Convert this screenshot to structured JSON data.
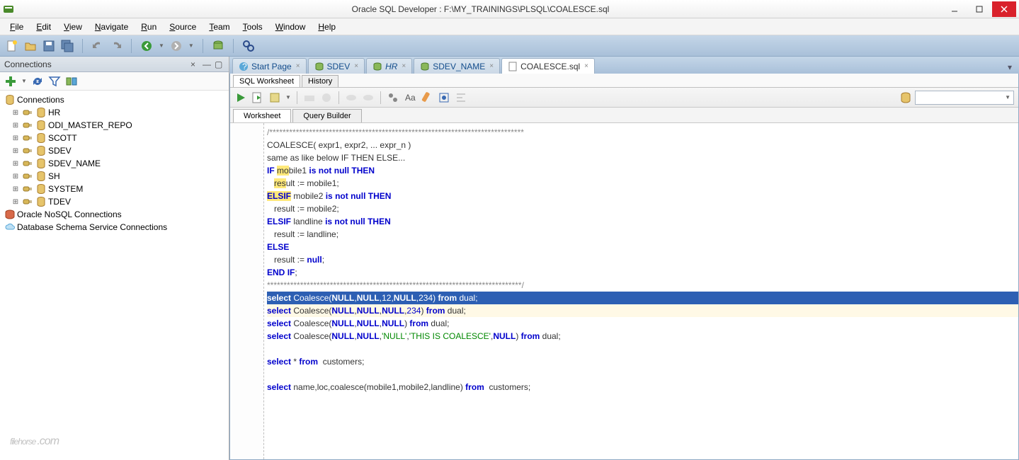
{
  "window": {
    "title": "Oracle SQL Developer : F:\\MY_TRAININGS\\PLSQL\\COALESCE.sql"
  },
  "menu": [
    "File",
    "Edit",
    "View",
    "Navigate",
    "Run",
    "Source",
    "Team",
    "Tools",
    "Window",
    "Help"
  ],
  "connections_panel": {
    "title": "Connections",
    "root": "Connections",
    "nodes": [
      "HR",
      "ODI_MASTER_REPO",
      "SCOTT",
      "SDEV",
      "SDEV_NAME",
      "SH",
      "SYSTEM",
      "TDEV"
    ],
    "extra": [
      "Oracle NoSQL Connections",
      "Database Schema Service Connections"
    ]
  },
  "doc_tabs": [
    {
      "label": "Start Page",
      "icon": "help"
    },
    {
      "label": "SDEV",
      "icon": "db"
    },
    {
      "label": "HR",
      "icon": "db",
      "italic": true
    },
    {
      "label": "SDEV_NAME",
      "icon": "db"
    },
    {
      "label": "COALESCE.sql",
      "icon": "sql",
      "active": true
    }
  ],
  "sub_tabs": [
    "SQL Worksheet",
    "History"
  ],
  "editor_tabs": [
    "Worksheet",
    "Query Builder"
  ],
  "code_lines": [
    {
      "t": "cm",
      "text": "/*****************************************************************************"
    },
    {
      "t": "id",
      "text": "COALESCE( expr1, expr2, ... expr_n )"
    },
    {
      "t": "id",
      "text": "same as like below IF THEN ELSE..."
    },
    {
      "t": "raw",
      "html": "<span class='kw'>IF</span> <span class='hl'>mo</span>bile1 <span class='kw'>is</span> <span class='kw'>not</span> <span class='kw'>null</span> <span class='kw'>THEN</span>"
    },
    {
      "t": "raw",
      "html": "   <span class='hl'>res</span>ult := mobile1;"
    },
    {
      "t": "raw",
      "html": "<span class='hl'><span class='kw'>ELSIF</span></span> mobile2 <span class='kw'>is</span> <span class='kw'>not</span> <span class='kw'>null</span> <span class='kw'>THEN</span>"
    },
    {
      "t": "id",
      "text": "   result := mobile2;"
    },
    {
      "t": "raw",
      "html": "<span class='kw'>ELSIF</span> landline <span class='kw'>is</span> <span class='kw'>not</span> <span class='kw'>null</span> <span class='kw'>THEN</span>"
    },
    {
      "t": "id",
      "text": "   result := landline;"
    },
    {
      "t": "raw",
      "html": "<span class='kw'>ELSE</span>"
    },
    {
      "t": "raw",
      "html": "   result := <span class='kw'>null</span>;"
    },
    {
      "t": "raw",
      "html": "<span class='kw'>END</span> <span class='kw'>IF</span>;"
    },
    {
      "t": "cm",
      "text": "*****************************************************************************/"
    },
    {
      "t": "sel",
      "html": "<span class='kw'>select</span> Coalesce(<span class='kw'>NULL</span>,<span class='kw'>NULL</span>,<span class='num'>12</span>,<span class='kw'>NULL</span>,<span class='num'>234</span>) <span class='kw'>from</span> dual;"
    },
    {
      "t": "cur",
      "html": "<span class='kw'>select</span> Coalesce(<span class='kw'>NULL</span>,<span class='kw'>NULL</span>,<span class='kw'>NULL</span>,<span class='num'>234</span>) <span class='kw'>from</span> dual;"
    },
    {
      "t": "raw",
      "html": "<span class='kw'>select</span> Coalesce(<span class='kw'>NULL</span>,<span class='kw'>NULL</span>,<span class='kw'>NULL</span>) <span class='kw'>from</span> dual;"
    },
    {
      "t": "raw",
      "html": "<span class='kw'>select</span> Coalesce(<span class='kw'>NULL</span>,<span class='kw'>NULL</span>,<span class='str'>'NULL'</span>,<span class='str'>'THIS IS COALESCE'</span>,<span class='kw'>NULL</span>) <span class='kw'>from</span> dual;"
    },
    {
      "t": "blank",
      "text": ""
    },
    {
      "t": "raw",
      "html": "<span class='kw'>select</span> * <span class='kw'>from</span>  customers;"
    },
    {
      "t": "blank",
      "text": ""
    },
    {
      "t": "raw",
      "html": "<span class='kw'>select</span> name,loc,coalesce(mobile1,mobile2,landline) <span class='kw'>from</span>  customers;"
    }
  ],
  "watermark": {
    "main": "filehorse",
    "suffix": ".com"
  }
}
